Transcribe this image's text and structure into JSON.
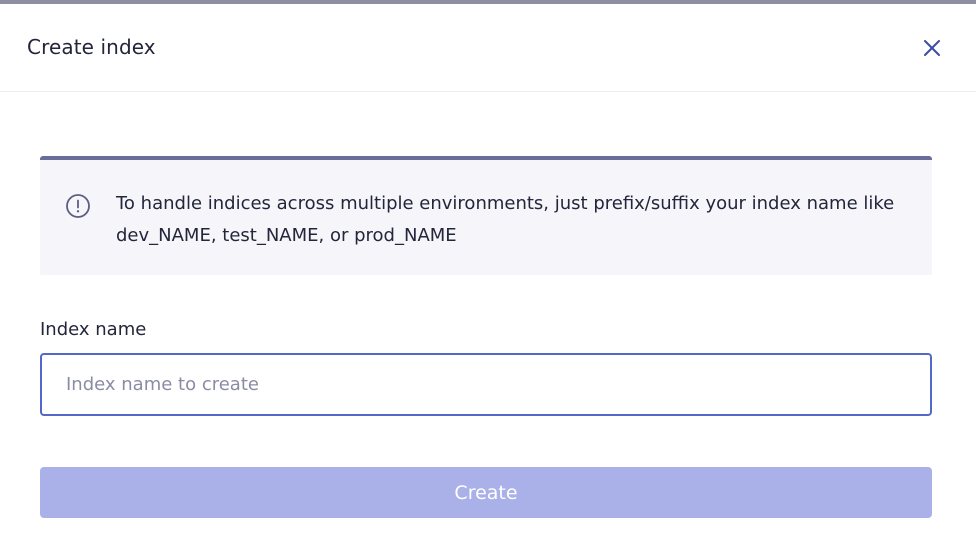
{
  "modal": {
    "title": "Create index",
    "close_icon": "close-icon"
  },
  "info": {
    "icon": "info-circle-icon",
    "text": "To handle indices across multiple environments, just prefix/suffix your index name like dev_NAME, test_NAME, or prod_NAME"
  },
  "form": {
    "label": "Index name",
    "input_value": "",
    "placeholder": "Index name to create",
    "submit_label": "Create"
  },
  "colors": {
    "accent": "#5468c9",
    "info_border": "#6a6c9a",
    "info_bg": "#f5f5fa",
    "button_disabled": "#a9b1e8"
  }
}
